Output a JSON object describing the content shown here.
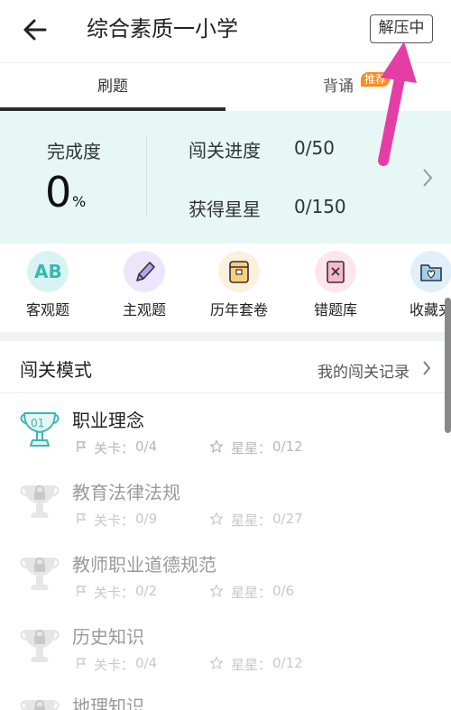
{
  "header": {
    "title": "综合素质一小学",
    "unzip_button": "解压中"
  },
  "tabs": [
    {
      "label": "刷题",
      "active": true
    },
    {
      "label": "背诵",
      "badge": "推荐"
    }
  ],
  "progress": {
    "completion_label": "完成度",
    "completion_value": "0",
    "completion_unit": "%",
    "level_progress_label": "闯关进度",
    "level_progress_value": "0/50",
    "stars_label": "获得星星",
    "stars_value": "0/150"
  },
  "categories": [
    {
      "label": "客观题",
      "icon": "ab-icon",
      "color": "#d9f3f4"
    },
    {
      "label": "主观题",
      "icon": "pencil-icon",
      "color": "#ece5fb"
    },
    {
      "label": "历年套卷",
      "icon": "paper-bag-icon",
      "color": "#fdf0de"
    },
    {
      "label": "错题库",
      "icon": "wrong-paper-icon",
      "color": "#fde6ee"
    },
    {
      "label": "收藏夹",
      "icon": "folder-heart-icon",
      "color": "#e0f0fb"
    }
  ],
  "section": {
    "title": "闯关模式",
    "link": "我的闯关记录"
  },
  "levels": [
    {
      "name": "职业理念",
      "badge": "01",
      "locked": false,
      "stage_label": "关卡：",
      "stage_value": "0/4",
      "star_label": "星星：",
      "star_value": "0/12"
    },
    {
      "name": "教育法律法规",
      "locked": true,
      "stage_label": "关卡：",
      "stage_value": "0/9",
      "star_label": "星星：",
      "star_value": "0/27"
    },
    {
      "name": "教师职业道德规范",
      "locked": true,
      "stage_label": "关卡：",
      "stage_value": "0/2",
      "star_label": "星星：",
      "star_value": "0/6"
    },
    {
      "name": "历史知识",
      "locked": true,
      "stage_label": "关卡：",
      "stage_value": "0/4",
      "star_label": "星星：",
      "star_value": "0/12"
    },
    {
      "name": "地理知识",
      "locked": true
    }
  ],
  "colors": {
    "accent_teal": "#3ab8b0",
    "badge_orange": "#ff8a1f",
    "arrow_pink": "#e43ea6",
    "progress_bg": "#e6f7f6"
  }
}
